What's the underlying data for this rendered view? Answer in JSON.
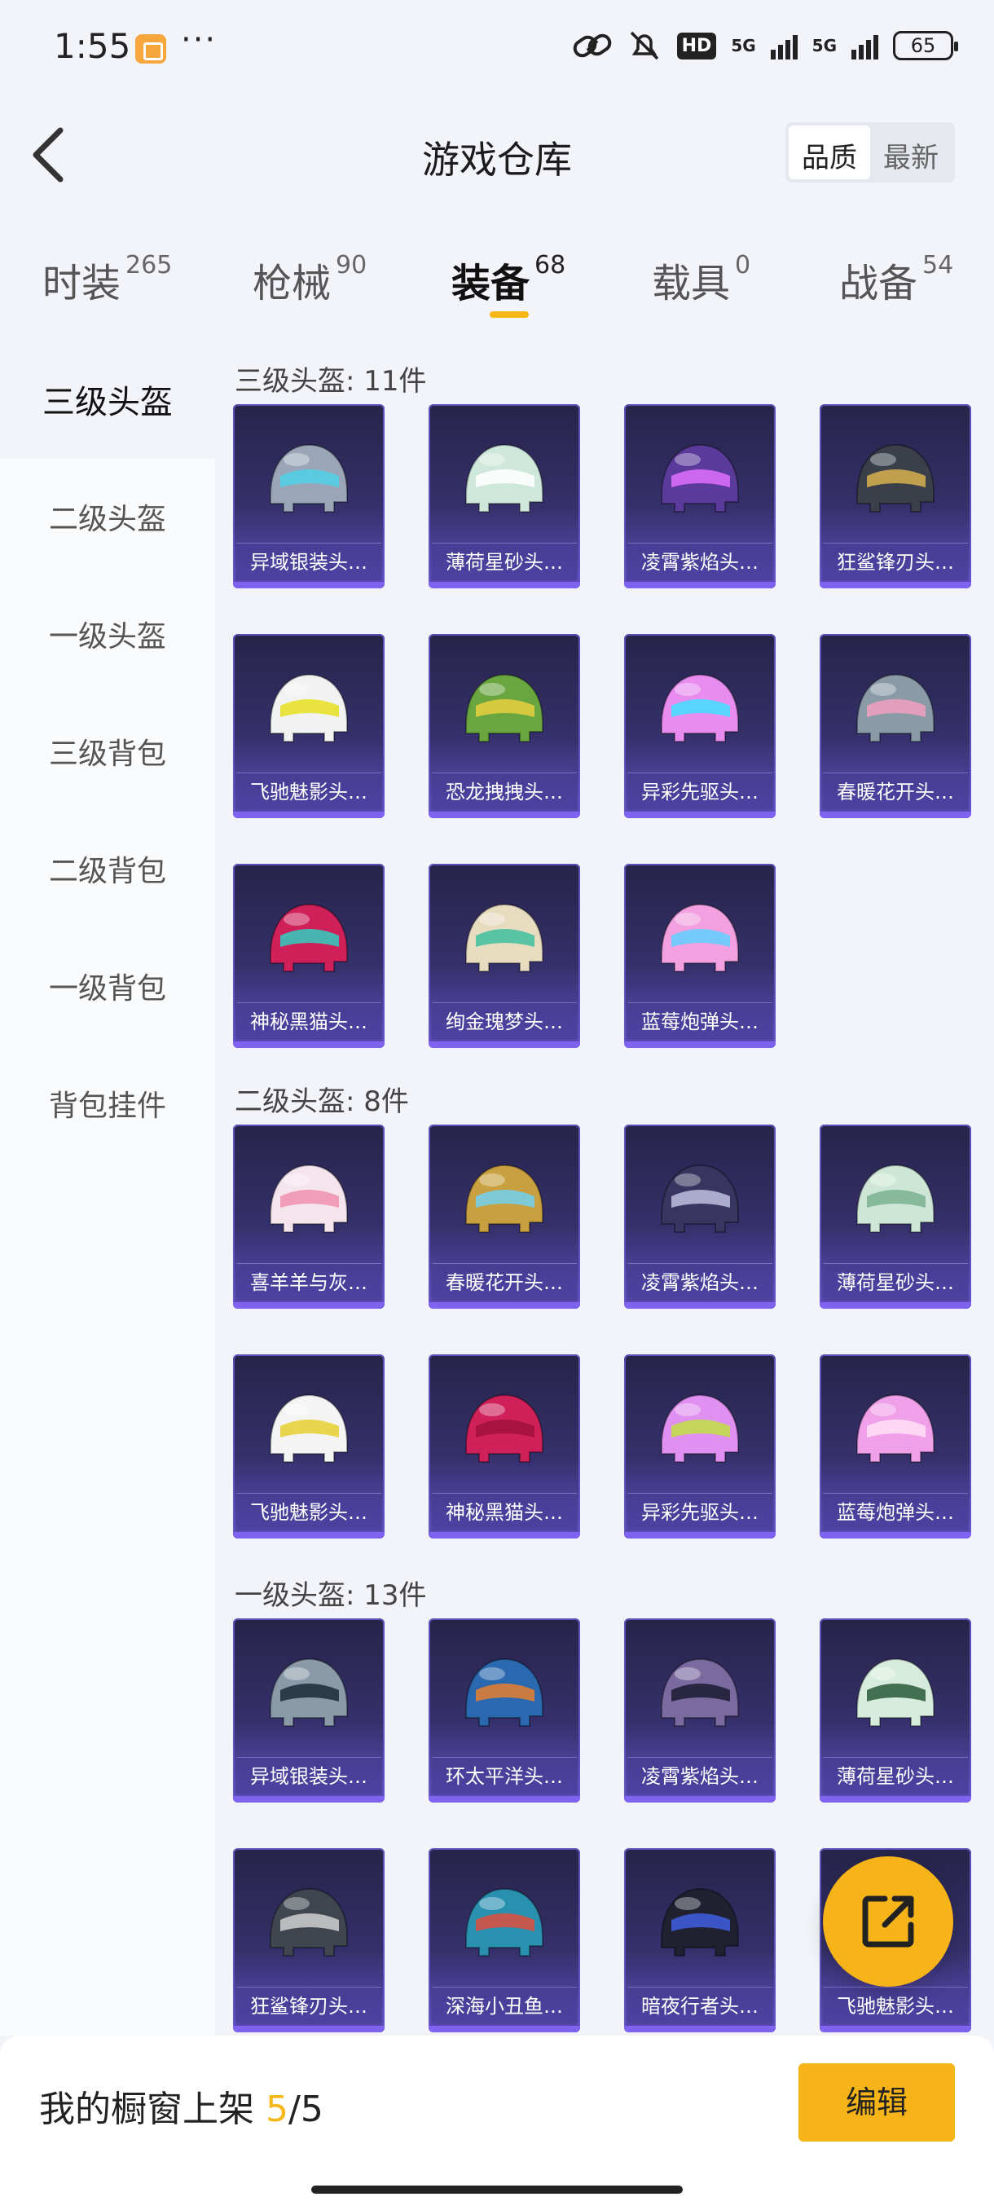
{
  "status": {
    "time": "1:55",
    "battery": "65",
    "hd": "HD",
    "net1": "5G",
    "net2": "5G"
  },
  "header": {
    "title": "游戏仓库",
    "sort": [
      "品质",
      "最新"
    ],
    "sort_selected": "品质"
  },
  "tabs": [
    {
      "label": "时装",
      "count": "265"
    },
    {
      "label": "枪械",
      "count": "90"
    },
    {
      "label": "装备",
      "count": "68"
    },
    {
      "label": "载具",
      "count": "0"
    },
    {
      "label": "战备",
      "count": "54"
    }
  ],
  "active_tab": "装备",
  "sidebar": [
    "三级头盔",
    "二级头盔",
    "一级头盔",
    "三级背包",
    "二级背包",
    "一级背包",
    "背包挂件"
  ],
  "sidebar_selected": "三级头盔",
  "sections": [
    {
      "title": "三级头盔: 11件",
      "items": [
        {
          "name": "异域银装头…",
          "color": "#9aa6b8",
          "accent": "#4fd0e8"
        },
        {
          "name": "薄荷星砂头…",
          "color": "#cfe8dc",
          "accent": "#ffffff"
        },
        {
          "name": "凌霄紫焰头…",
          "color": "#5a3a9a",
          "accent": "#e070ff"
        },
        {
          "name": "狂鲨锋刃头…",
          "color": "#3a3f4a",
          "accent": "#d8b050"
        },
        {
          "name": "飞驰魅影头…",
          "color": "#f2f2f2",
          "accent": "#e8e020"
        },
        {
          "name": "恐龙拽拽头…",
          "color": "#6aa640",
          "accent": "#e8d040"
        },
        {
          "name": "异彩先驱头…",
          "color": "#e88cf0",
          "accent": "#40e0ff"
        },
        {
          "name": "春暖花开头…",
          "color": "#8a9aa6",
          "accent": "#f0a0c0"
        },
        {
          "name": "神秘黑猫头…",
          "color": "#d0205a",
          "accent": "#30d0c0"
        },
        {
          "name": "绚金瑰梦头…",
          "color": "#e8dcc0",
          "accent": "#3fbf9f"
        },
        {
          "name": "蓝莓炮弹头…",
          "color": "#f2a0e0",
          "accent": "#60d0ff"
        }
      ]
    },
    {
      "title": "二级头盔: 8件",
      "items": [
        {
          "name": "喜羊羊与灰…",
          "color": "#f4e4ec",
          "accent": "#f090b0"
        },
        {
          "name": "春暖花开头…",
          "color": "#c8a040",
          "accent": "#70d0f0"
        },
        {
          "name": "凌霄紫焰头…",
          "color": "#3a3560",
          "accent": "#c0c0e0"
        },
        {
          "name": "薄荷星砂头…",
          "color": "#cde6d6",
          "accent": "#7ab090"
        },
        {
          "name": "飞驰魅影头…",
          "color": "#f4f4f4",
          "accent": "#e8d030"
        },
        {
          "name": "神秘黑猫头…",
          "color": "#d0205a",
          "accent": "#a01040"
        },
        {
          "name": "异彩先驱头…",
          "color": "#e090f0",
          "accent": "#c0e040"
        },
        {
          "name": "蓝莓炮弹头…",
          "color": "#f0a0e8",
          "accent": "#ffe0f4"
        }
      ]
    },
    {
      "title": "一级头盔: 13件",
      "items": [
        {
          "name": "异域银装头…",
          "color": "#8a9aa8",
          "accent": "#1a2a3a"
        },
        {
          "name": "环太平洋头…",
          "color": "#2a68b0",
          "accent": "#e88030"
        },
        {
          "name": "凌霄紫焰头…",
          "color": "#7a6aa0",
          "accent": "#1a1a30"
        },
        {
          "name": "薄荷星砂头…",
          "color": "#d6ecdc",
          "accent": "#2a5a3a"
        },
        {
          "name": "狂鲨锋刃头…",
          "color": "#404650",
          "accent": "#d0d0d0"
        },
        {
          "name": "深海小丑鱼…",
          "color": "#2a90b0",
          "accent": "#e05040"
        },
        {
          "name": "暗夜行者头…",
          "color": "#202030",
          "accent": "#4060e0"
        },
        {
          "name": "飞驰魅影头…",
          "color": "#e6e6f0",
          "accent": "#404050"
        }
      ]
    }
  ],
  "showcase": {
    "label": "我的橱窗上架",
    "current": "5",
    "total": "/5"
  },
  "edit_button": "编辑",
  "accent_color": "#f7b418"
}
